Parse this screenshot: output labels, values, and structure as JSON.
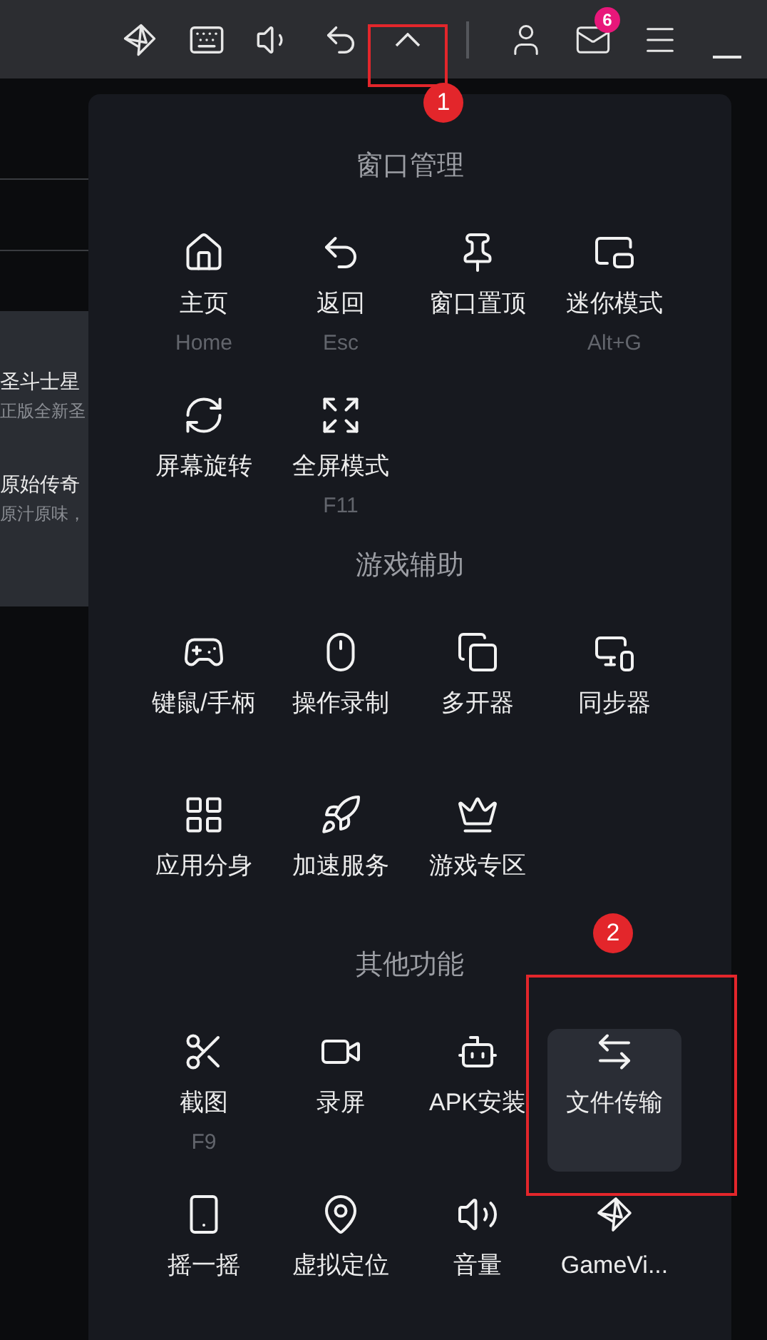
{
  "toolbar": {
    "mail_badge": "6"
  },
  "background_card": {
    "items": [
      {
        "title": "圣斗士星",
        "subtitle": "正版全新圣"
      },
      {
        "title": "原始传奇",
        "subtitle": "原汁原味，"
      }
    ]
  },
  "menu": {
    "sections": [
      {
        "title": "窗口管理",
        "items": [
          {
            "label": "主页",
            "shortcut": "Home",
            "selected": false
          },
          {
            "label": "返回",
            "shortcut": "Esc",
            "selected": false
          },
          {
            "label": "窗口置顶",
            "selected": false
          },
          {
            "label": "迷你模式",
            "shortcut": "Alt+G",
            "selected": false
          },
          {
            "label": "屏幕旋转",
            "selected": false
          },
          {
            "label": "全屏模式",
            "shortcut": "F11",
            "selected": false
          }
        ]
      },
      {
        "title": "游戏辅助",
        "items": [
          {
            "label": "键鼠/手柄",
            "selected": false
          },
          {
            "label": "操作录制",
            "selected": false
          },
          {
            "label": "多开器",
            "selected": false
          },
          {
            "label": "同步器",
            "selected": false
          },
          {
            "label": "应用分身",
            "selected": false
          },
          {
            "label": "加速服务",
            "selected": false
          },
          {
            "label": "游戏专区",
            "selected": false
          }
        ]
      },
      {
        "title": "其他功能",
        "items": [
          {
            "label": "截图",
            "shortcut": "F9",
            "selected": false
          },
          {
            "label": "录屏",
            "selected": false
          },
          {
            "label": "APK安装",
            "selected": false
          },
          {
            "label": "文件传输",
            "selected": true
          },
          {
            "label": "摇一摇",
            "selected": false
          },
          {
            "label": "虚拟定位",
            "selected": false
          },
          {
            "label": "音量",
            "selected": false
          },
          {
            "label": "GameVi...",
            "selected": false
          }
        ]
      }
    ]
  },
  "annotations": [
    {
      "number": "1"
    },
    {
      "number": "2"
    }
  ]
}
